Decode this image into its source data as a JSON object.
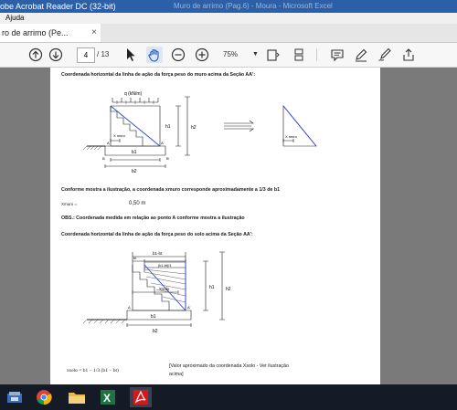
{
  "window": {
    "title": "obe Acrobat Reader DC (32-bit)",
    "title_center": "Muro de arrimo (Pag.6) - Moura - Microsoft Excel"
  },
  "menu": {
    "help": "Ajuda"
  },
  "tab": {
    "label": "ro de arrimo (Pe...",
    "close": "×"
  },
  "toolbar": {
    "page_current": "4",
    "page_total": "/ 13",
    "zoom": "75%"
  },
  "document": {
    "h1": "Coordenada horizontal da linha de ação da força peso do muro acima da Seção AA':",
    "fig1": {
      "q": "q (kN/m)",
      "h1": "h1",
      "h2": "h2",
      "xmuro": "X muro",
      "b1": "b1",
      "b2": "b2",
      "A": "A",
      "A2": "A'",
      "B": "B",
      "B2": "B'",
      "xmuro2": "X muro"
    },
    "p1": "Conforme mostra a ilustração, a coordenada xmuro corresponde aproximadamente a 1/3 de b1",
    "xmuro_label": "Xmuro =",
    "xmuro_value": "0,50  m",
    "obs": "OBS.: Coordenada medida em relação ao ponto A conforme mostra a ilustração",
    "h2": "Coordenada horizontal da linha de ação da força peso do solo acima da Seção AA':",
    "fig2": {
      "b1b": "b1-bt",
      "bt": "bt",
      "b1mid": "(b1-bt)/3",
      "xsolo": "Xsolo",
      "h1": "h1",
      "h2": "h2",
      "b1": "b1",
      "b2": "b2",
      "A": "A",
      "A2": "A'"
    },
    "formula": "xsolo = b1 − 1/3 (b1 − bt)",
    "formula_note_1": "[Valor aproximado da coordenada Xsolo - Ver ilustração",
    "formula_note_2": "acima]"
  },
  "taskbar": {
    "items": [
      "file-explorer-icon",
      "chrome-icon",
      "folder-icon",
      "excel-icon",
      "acrobat-icon"
    ]
  },
  "colors": {
    "accent": "#2b5fa8",
    "diagram_blue": "#2f3fd0",
    "taskbar": "#141a26"
  }
}
